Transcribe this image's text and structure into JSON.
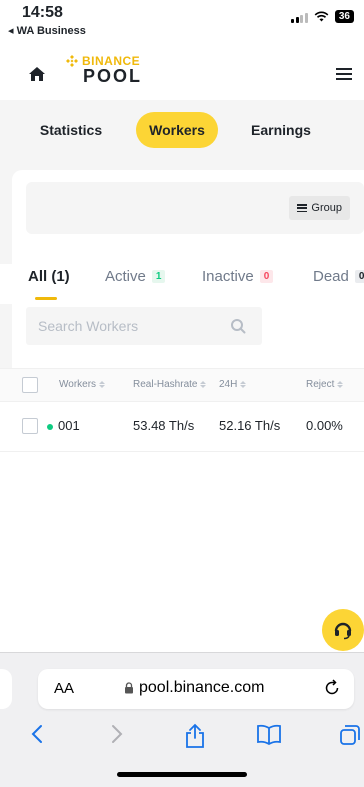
{
  "status_bar": {
    "time": "14:58",
    "back_label": "◂ WA Business",
    "battery": "36"
  },
  "header": {
    "brand_top": "BINANCE",
    "brand_bottom": "POOL"
  },
  "tabs": [
    {
      "label": "Statistics",
      "active": false
    },
    {
      "label": "Workers",
      "active": true
    },
    {
      "label": "Earnings",
      "active": false
    }
  ],
  "group_button": {
    "label": "Group"
  },
  "filters": {
    "all": {
      "label": "All (1)"
    },
    "active": {
      "label": "Active",
      "count": "1"
    },
    "inactive": {
      "label": "Inactive",
      "count": "0"
    },
    "dead": {
      "label": "Dead",
      "count": "0"
    }
  },
  "search": {
    "placeholder": "Search Workers"
  },
  "table": {
    "columns": [
      "Workers",
      "Real-Hashrate",
      "24H",
      "Reject"
    ],
    "rows": [
      {
        "worker": "001",
        "real_hashrate": "53.48 Th/s",
        "h24": "52.16 Th/s",
        "reject": "0.00%"
      }
    ]
  },
  "browser": {
    "aa": "AA",
    "url": "pool.binance.com"
  },
  "colors": {
    "accent": "#fcd535",
    "brand": "#f0b90b",
    "online": "#0ecb81",
    "danger": "#f6465d"
  }
}
